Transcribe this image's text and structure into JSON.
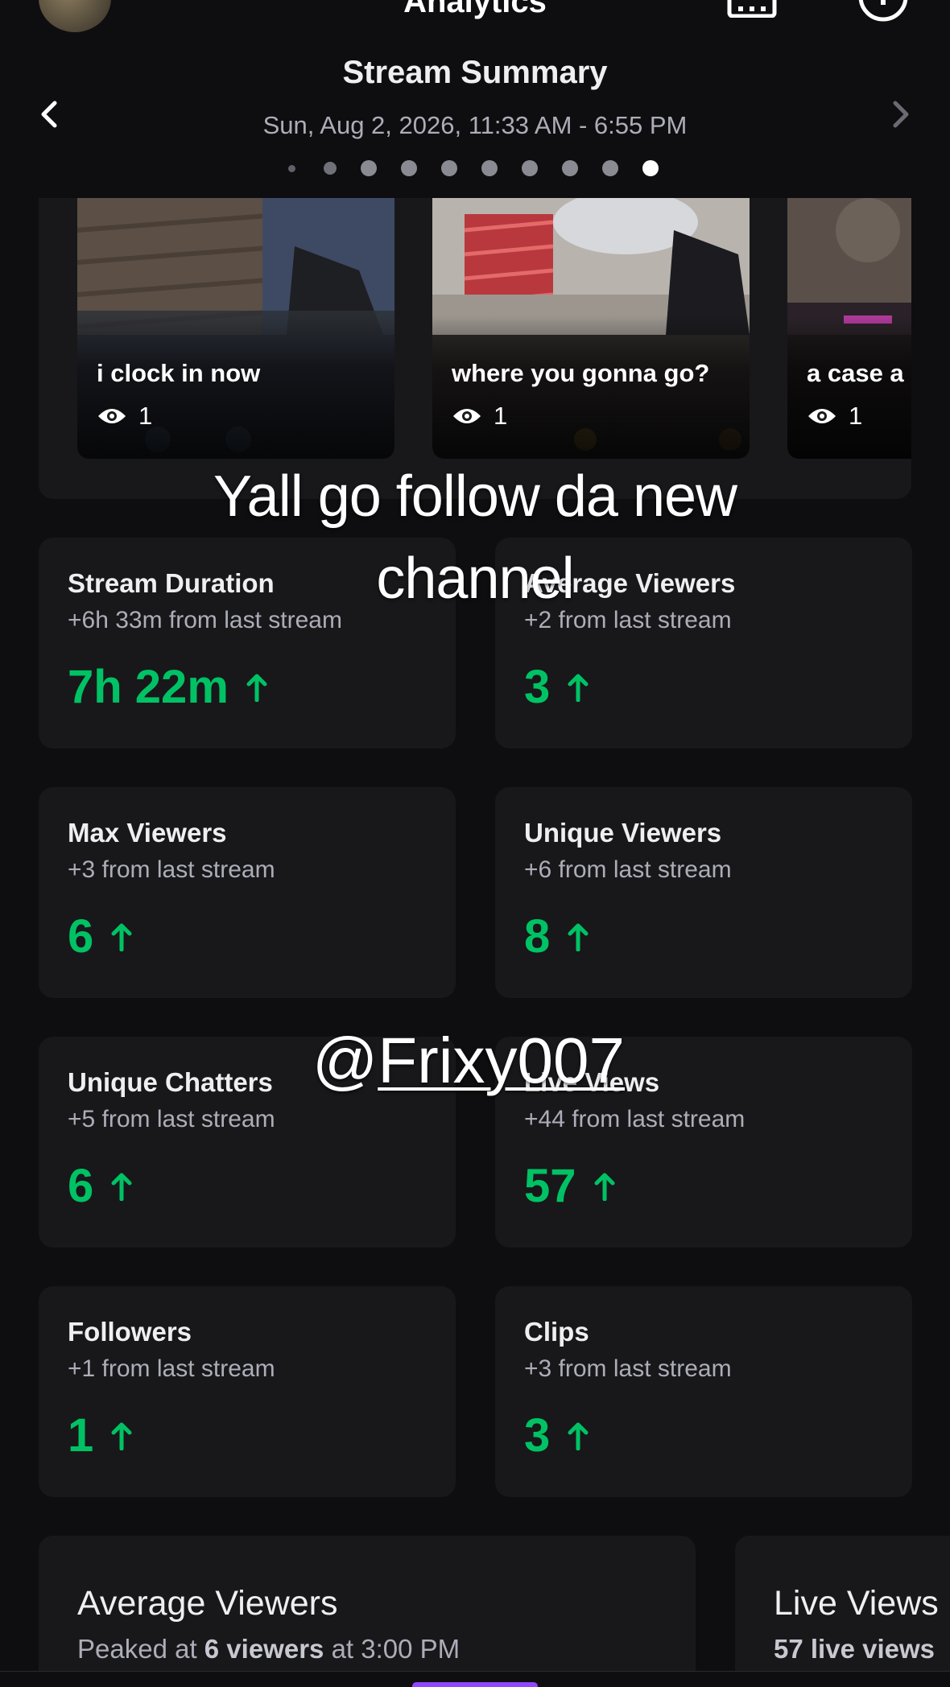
{
  "header": {
    "title": "Analytics",
    "summary_title": "Stream Summary",
    "date_range": "Sun, Aug 2, 2026, 11:33 AM - 6:55 PM",
    "page_dots": {
      "count": 10,
      "active_index": 9
    }
  },
  "clips": [
    {
      "title": "i clock in now",
      "views": "1"
    },
    {
      "title": "where you gonna go?",
      "views": "1"
    },
    {
      "title": "a case a",
      "views": "1"
    }
  ],
  "overlays": {
    "caption": "Yall go follow da new channel",
    "handle_prefix": "@",
    "handle_name": "Frixy007"
  },
  "stats": [
    {
      "label": "Stream Duration",
      "delta": "+6h 33m from last stream",
      "value": "7h 22m"
    },
    {
      "label": "Average Viewers",
      "delta": "+2 from last stream",
      "value": "3"
    },
    {
      "label": "Max Viewers",
      "delta": "+3 from last stream",
      "value": "6"
    },
    {
      "label": "Unique Viewers",
      "delta": "+6 from last stream",
      "value": "8"
    },
    {
      "label": "Unique Chatters",
      "delta": "+5 from last stream",
      "value": "6"
    },
    {
      "label": "Live Views",
      "delta": "+44 from last stream",
      "value": "57"
    },
    {
      "label": "Followers",
      "delta": "+1 from last stream",
      "value": "1"
    },
    {
      "label": "Clips",
      "delta": "+3 from last stream",
      "value": "3"
    }
  ],
  "charts": [
    {
      "title": "Average Viewers",
      "sub_prefix": "Peaked at ",
      "sub_bold": "6 viewers",
      "sub_suffix": " at 3:00 PM"
    },
    {
      "title": "Live Views",
      "sub_bold": "57 live views"
    }
  ],
  "colors": {
    "background": "#0e0e10",
    "card": "#18181b",
    "positive": "#00c264",
    "muted_text": "#adadb8",
    "accent": "#9147ff"
  }
}
